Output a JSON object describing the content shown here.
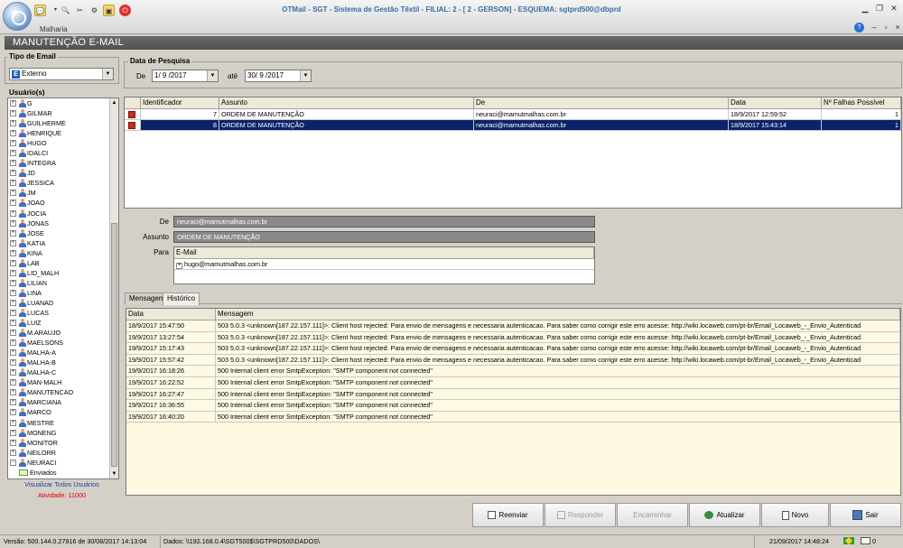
{
  "window": {
    "title": "OTMail - SGT - Sistema de Gestão Têxtil - FILIAL: 2 - [ 2 - GERSON] - ESQUEMA: sgtprd500@dbprd",
    "module": "Malharia",
    "header": "MANUTENÇÃO E-MAIL"
  },
  "filters": {
    "tipo_label": "Tipo de Email",
    "tipo_value": "Externo",
    "data_label": "Data de Pesquisa",
    "de_label": "De",
    "de_value": "1/ 9 /2017",
    "ate_label": "até",
    "ate_value": "30/ 9 /2017"
  },
  "users": {
    "label": "Usuário(s)",
    "items": [
      "G",
      "GILMAR",
      "GUILHERME",
      "HENRIQUE",
      "HUGO",
      "IDALCI",
      "INTEGRA",
      "JD",
      "JESSICA",
      "JM",
      "JOAO",
      "JOCIA",
      "JONAS",
      "JOSE",
      "KATIA",
      "KINA",
      "LAB",
      "LID_MALH",
      "LILIAN",
      "LINA",
      "LUANAD",
      "LUCAS",
      "LUIZ",
      "M.ARAUJO",
      "MAELSONS",
      "MALHA-A",
      "MALHA-B",
      "MALHA-C",
      "MAN-MALH",
      "MANUTENCAO",
      "MARCIANA",
      "MARCO",
      "MESTRE",
      "MONENG",
      "MONITOR",
      "NEILORR",
      "NEURACI"
    ],
    "child": "Enviados",
    "view_all": "Visualizar Todos Usuários",
    "activity": "Atividade: 11000"
  },
  "messages": {
    "columns": [
      "Identificador",
      "Assunto",
      "De",
      "Data",
      "Nº Falhas Possível"
    ],
    "rows": [
      {
        "id": "7",
        "subject": "ORDEM DE MANUTENÇÃO",
        "from": "neuraci@mamutmalhas.com.br",
        "date": "18/9/2017 12:59:52",
        "fails": "1"
      },
      {
        "id": "8",
        "subject": "ORDEM DE MANUTENÇÃO",
        "from": "neuraci@mamutmalhas.com.br",
        "date": "18/9/2017 15:43:14",
        "fails": "1"
      }
    ]
  },
  "detail": {
    "de_label": "De",
    "de_value": "neuraci@mamutmalhas.com.br",
    "assunto_label": "Assunto",
    "assunto_value": "ORDEM DE MANUTENÇÃO",
    "para_label": "Para",
    "email_header": "E-Mail",
    "recipient": "hugo@mamutmalhas.com.br"
  },
  "tabs": [
    "Mensagem",
    "Histórico"
  ],
  "history": {
    "columns": [
      "Data",
      "Mensagem"
    ],
    "rows": [
      {
        "date": "18/9/2017 15:47:50",
        "msg": "503 5.0.3 <unknown[187.22.157.111]>: Client host rejected: Para envio de mensagens e necessaria autenticacao. Para saber como corrigir este erro acesse: http://wiki.locaweb.com/pt-br/Email_Locaweb_-_Envio_Autenticad"
      },
      {
        "date": "19/9/2017 13:27:54",
        "msg": "503 5.0.3 <unknown[187.22.157.111]>: Client host rejected: Para envio de mensagens e necessaria autenticacao. Para saber como corrigir este erro acesse: http://wiki.locaweb.com/pt-br/Email_Locaweb_-_Envio_Autenticad"
      },
      {
        "date": "19/9/2017 15:17:43",
        "msg": "503 5.0.3 <unknown[187.22.157.111]>: Client host rejected: Para envio de mensagens e necessaria autenticacao. Para saber como corrigir este erro acesse: http://wiki.locaweb.com/pt-br/Email_Locaweb_-_Envio_Autenticad"
      },
      {
        "date": "19/9/2017 15:57:42",
        "msg": "503 5.0.3 <unknown[187.22.157.111]>: Client host rejected: Para envio de mensagens e necessaria autenticacao. Para saber como corrigir este erro acesse: http://wiki.locaweb.com/pt-br/Email_Locaweb_-_Envio_Autenticad"
      },
      {
        "date": "19/9/2017 16:18:26",
        "msg": "500 Internal client error SmtpException: \"SMTP component not connected\""
      },
      {
        "date": "19/9/2017 16:22:52",
        "msg": "500 Internal client error SmtpException: \"SMTP component not connected\""
      },
      {
        "date": "19/9/2017 16:27:47",
        "msg": "500 Internal client error SmtpException: \"SMTP component not connected\""
      },
      {
        "date": "19/9/2017 16:36:55",
        "msg": "500 Internal client error SmtpException: \"SMTP component not connected\""
      },
      {
        "date": "19/9/2017 16:40:20",
        "msg": "500 Internal client error SmtpException: \"SMTP component not connected\""
      }
    ]
  },
  "buttons": {
    "reenviar": "Reenviar",
    "responder": "Responder",
    "encaminhar": "Encaminhar",
    "atualizar": "Atualizar",
    "novo": "Novo",
    "sair": "Sair"
  },
  "status": {
    "version": "Versão: 500.144.0.27916 de 30/08/2017 14:13:04",
    "dados": "Dados: \\\\192.168.0.4\\SGT500$\\SGTPRD500\\DADOS\\",
    "datetime": "21/09/2017 14:48:24",
    "mail_count": "0"
  },
  "colors": {
    "selection": "#0a246a",
    "header_bar": "#5a5a5a",
    "title_text": "#3a6ea5",
    "history_bg": "#fdf8e0",
    "activity_red": "#e00000",
    "link_blue": "#2040a0"
  }
}
